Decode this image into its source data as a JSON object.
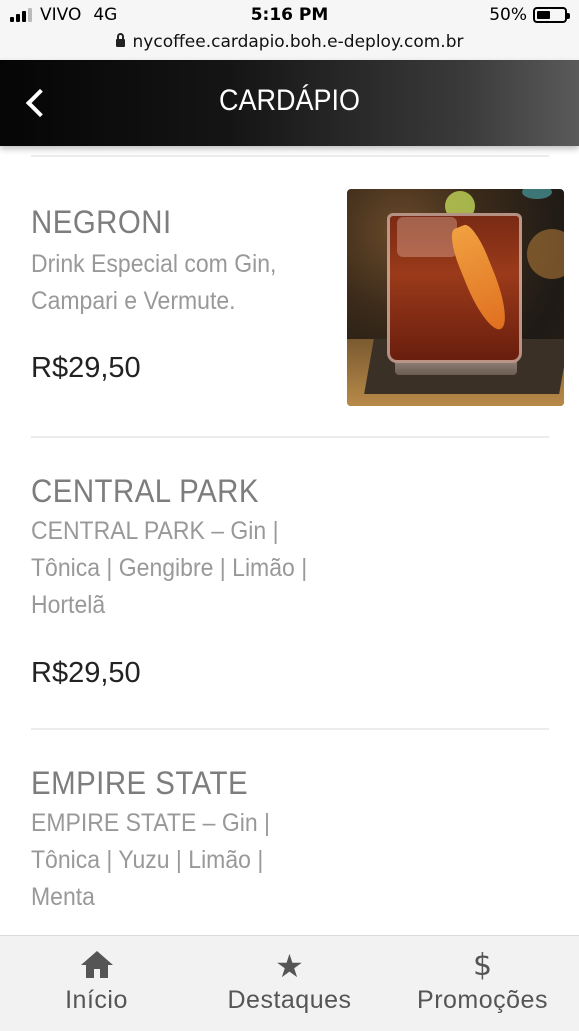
{
  "status_bar": {
    "carrier": "VIVO",
    "network": "4G",
    "time": "5:16 PM",
    "battery": "50%",
    "battery_level": 0.5,
    "url": "nycoffee.cardapio.boh.e-deploy.com.br"
  },
  "header": {
    "title": "CARDÁPIO",
    "back_icon": "chevron-left-icon"
  },
  "menu_items": [
    {
      "name": "NEGRONI",
      "description": "Drink Especial com Gin, Campari e Vermute.",
      "price": "R$29,50",
      "has_photo": true
    },
    {
      "name": "CENTRAL PARK",
      "description": "CENTRAL PARK – Gin | Tônica | Gengibre | Limão | Hortelã",
      "price": "R$29,50",
      "has_photo": false
    },
    {
      "name": "EMPIRE STATE",
      "description": "EMPIRE STATE – Gin | Tônica | Yuzu | Limão | Menta",
      "has_photo": false
    }
  ],
  "tab_bar": {
    "tabs": [
      {
        "label": "Início",
        "icon": "home-icon"
      },
      {
        "label": "Destaques",
        "icon": "star-icon"
      },
      {
        "label": "Promoções",
        "icon": "dollar-icon"
      }
    ]
  }
}
